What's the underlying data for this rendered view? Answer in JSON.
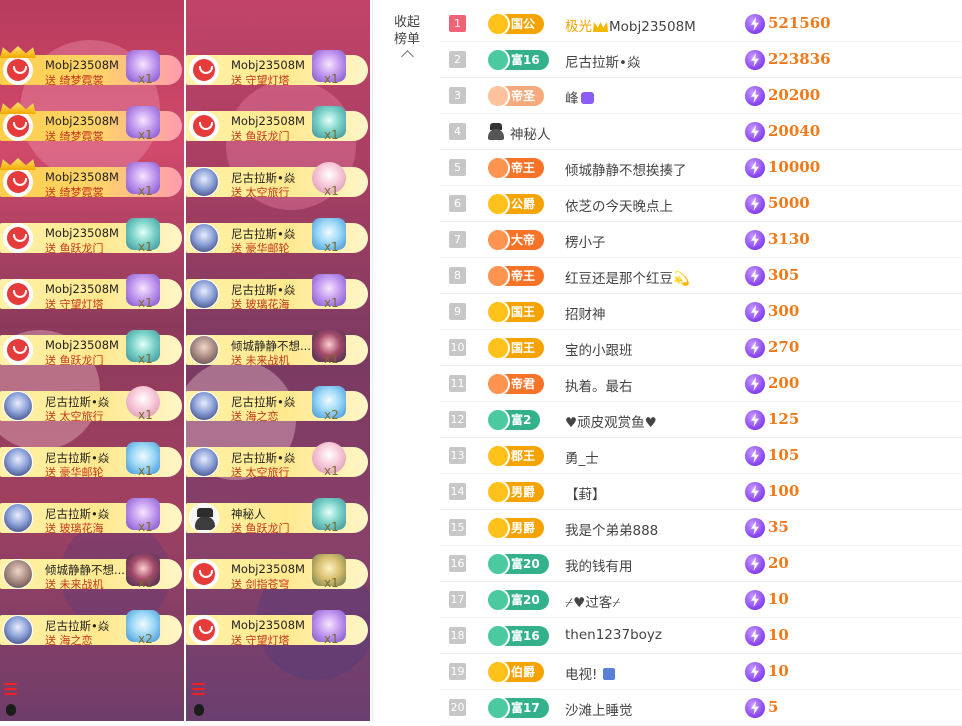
{
  "gift_stream_left": [
    {
      "user": "Mobj23508M",
      "action": "送",
      "gift": "绮梦霓裳",
      "count": "x1",
      "avatar": "red-face",
      "vip": true,
      "gift_icon": "purple"
    },
    {
      "user": "Mobj23508M",
      "action": "送",
      "gift": "绮梦霓裳",
      "count": "x1",
      "avatar": "red-face",
      "vip": true,
      "gift_icon": "purple"
    },
    {
      "user": "Mobj23508M",
      "action": "送",
      "gift": "绮梦霓裳",
      "count": "x1",
      "avatar": "red-face",
      "vip": true,
      "gift_icon": "purple"
    },
    {
      "user": "Mobj23508M",
      "action": "送",
      "gift": "鱼跃龙门",
      "count": "x1",
      "avatar": "red-face",
      "vip": false,
      "gift_icon": "teal"
    },
    {
      "user": "Mobj23508M",
      "action": "送",
      "gift": "守望灯塔",
      "count": "x1",
      "avatar": "red-face",
      "vip": false,
      "gift_icon": "purple"
    },
    {
      "user": "Mobj23508M",
      "action": "送",
      "gift": "鱼跃龙门",
      "count": "x1",
      "avatar": "red-face",
      "vip": false,
      "gift_icon": "teal"
    },
    {
      "user": "尼古拉斯•焱",
      "action": "送",
      "gift": "太空旅行",
      "count": "x1",
      "avatar": "anime",
      "vip": false,
      "gift_icon": "pink"
    },
    {
      "user": "尼古拉斯•焱",
      "action": "送",
      "gift": "豪华邮轮",
      "count": "x1",
      "avatar": "anime",
      "vip": false,
      "gift_icon": "blue"
    },
    {
      "user": "尼古拉斯•焱",
      "action": "送",
      "gift": "玻璃花海",
      "count": "x1",
      "avatar": "anime",
      "vip": false,
      "gift_icon": "purple"
    },
    {
      "user": "倾城静静不想...",
      "action": "送",
      "gift": "未来战机",
      "count": "x1",
      "avatar": "girl",
      "vip": false,
      "gift_icon": "dark"
    },
    {
      "user": "尼古拉斯•焱",
      "action": "送",
      "gift": "海之恋",
      "count": "x2",
      "avatar": "anime",
      "vip": false,
      "gift_icon": "blue"
    }
  ],
  "gift_stream_right": [
    {
      "user": "Mobj23508M",
      "action": "送",
      "gift": "守望灯塔",
      "count": "x1",
      "avatar": "red-face",
      "gift_icon": "purple"
    },
    {
      "user": "Mobj23508M",
      "action": "送",
      "gift": "鱼跃龙门",
      "count": "x1",
      "avatar": "red-face",
      "gift_icon": "teal"
    },
    {
      "user": "尼古拉斯•焱",
      "action": "送",
      "gift": "太空旅行",
      "count": "x1",
      "avatar": "anime",
      "gift_icon": "pink"
    },
    {
      "user": "尼古拉斯•焱",
      "action": "送",
      "gift": "豪华邮轮",
      "count": "x1",
      "avatar": "anime",
      "gift_icon": "blue"
    },
    {
      "user": "尼古拉斯•焱",
      "action": "送",
      "gift": "玻璃花海",
      "count": "x1",
      "avatar": "anime",
      "gift_icon": "purple"
    },
    {
      "user": "倾城静静不想...",
      "action": "送",
      "gift": "未来战机",
      "count": "x1",
      "avatar": "girl",
      "gift_icon": "dark"
    },
    {
      "user": "尼古拉斯•焱",
      "action": "送",
      "gift": "海之恋",
      "count": "x2",
      "avatar": "anime",
      "gift_icon": "blue"
    },
    {
      "user": "尼古拉斯•焱",
      "action": "送",
      "gift": "太空旅行",
      "count": "x1",
      "avatar": "anime",
      "gift_icon": "pink"
    },
    {
      "user": "神秘人",
      "action": "送",
      "gift": "鱼跃龙门",
      "count": "x1",
      "avatar": "mystery",
      "gift_icon": "teal"
    },
    {
      "user": "Mobj23508M",
      "action": "送",
      "gift": "剑指苍穹",
      "count": "x1",
      "avatar": "red-face",
      "gift_icon": "gold"
    },
    {
      "user": "Mobj23508M",
      "action": "送",
      "gift": "守望灯塔",
      "count": "x1",
      "avatar": "red-face",
      "gift_icon": "purple"
    }
  ],
  "sidebar": {
    "collapse_line1": "收起",
    "collapse_line2": "榜单"
  },
  "colors": {
    "rank_top": "#f06276",
    "score": "#f07a1a",
    "badge_gold": "#f5a300",
    "badge_teal": "#33b18b",
    "badge_orange": "#f77327"
  },
  "ranking": [
    {
      "rank": "1",
      "badge": "国公",
      "badge_style": "gold",
      "name": "极光",
      "name_suffix": "Mobj23508M",
      "name_style": "gold",
      "score": "521560",
      "deco": "crown"
    },
    {
      "rank": "2",
      "badge": "富16",
      "badge_style": "teal",
      "name": "尼古拉斯•焱",
      "score": "223836"
    },
    {
      "rank": "3",
      "badge": "帝圣",
      "badge_style": "peach",
      "name": "峰",
      "score": "20200",
      "deco": "heart"
    },
    {
      "rank": "4",
      "badge": "",
      "badge_style": "none",
      "name": "神秘人",
      "score": "20040",
      "deco": "mystery"
    },
    {
      "rank": "5",
      "badge": "帝王",
      "badge_style": "orange",
      "name": "倾城静静不想挨揍了",
      "score": "10000"
    },
    {
      "rank": "6",
      "badge": "公爵",
      "badge_style": "gold",
      "name": "依芝の今天晚点上",
      "score": "5000"
    },
    {
      "rank": "7",
      "badge": "大帝",
      "badge_style": "orange",
      "name": "楞小子",
      "score": "3130"
    },
    {
      "rank": "8",
      "badge": "帝王",
      "badge_style": "orange",
      "name": "红豆还是那个红豆💫",
      "score": "305"
    },
    {
      "rank": "9",
      "badge": "国王",
      "badge_style": "gold",
      "name": "招财神",
      "score": "300"
    },
    {
      "rank": "10",
      "badge": "国王",
      "badge_style": "gold",
      "name": "宝的小跟班",
      "score": "270"
    },
    {
      "rank": "11",
      "badge": "帝君",
      "badge_style": "orange",
      "name": "执着。最右",
      "score": "200"
    },
    {
      "rank": "12",
      "badge": "富2",
      "badge_style": "teal",
      "name": "♥顽皮观赏鱼♥",
      "score": "125"
    },
    {
      "rank": "13",
      "badge": "郡王",
      "badge_style": "gold",
      "name": "勇_士",
      "score": "105"
    },
    {
      "rank": "14",
      "badge": "男爵",
      "badge_style": "gold",
      "name": "【葑】",
      "score": "100"
    },
    {
      "rank": "15",
      "badge": "男爵",
      "badge_style": "gold",
      "name": "我是个弟弟888",
      "score": "35"
    },
    {
      "rank": "16",
      "badge": "富20",
      "badge_style": "teal",
      "name": "我的钱有用",
      "score": "20"
    },
    {
      "rank": "17",
      "badge": "富20",
      "badge_style": "teal",
      "name": "⌿♥过客⌿",
      "score": "10"
    },
    {
      "rank": "18",
      "badge": "富16",
      "badge_style": "teal",
      "name": "then1237boyz",
      "score": "10"
    },
    {
      "rank": "19",
      "badge": "伯爵",
      "badge_style": "gold",
      "name": "电视!",
      "score": "10",
      "deco": "mini"
    },
    {
      "rank": "20",
      "badge": "富17",
      "badge_style": "teal",
      "name": "沙滩上睡觉",
      "score": "5"
    }
  ]
}
